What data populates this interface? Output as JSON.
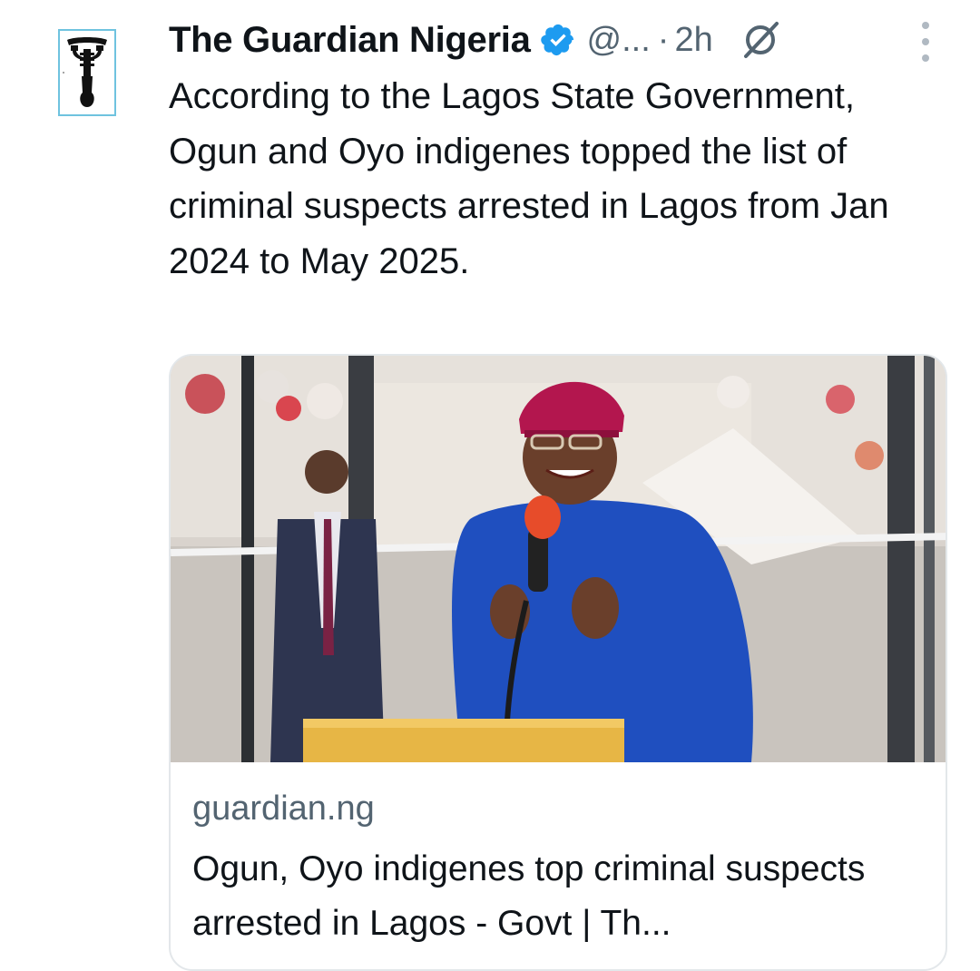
{
  "tweet": {
    "display_name": "The Guardian Nigeria",
    "verified_icon": "verified-badge-icon",
    "handle": "@...",
    "separator": "·",
    "time": "2h",
    "grok_icon": "grok-icon",
    "more_icon": "more-vertical-icon",
    "text": "According to the Lagos State Government, Ogun and Oyo indigenes topped the list of criminal suspects arrested in Lagos from Jan 2024 to May 2025."
  },
  "card": {
    "domain": "guardian.ng",
    "title": "Ogun, Oyo indigenes top criminal suspects arrested in Lagos - Govt | Th..."
  },
  "colors": {
    "verified": "#1d9bf0",
    "secondary_text": "#536471",
    "avatar_border": "#6fc3df"
  }
}
